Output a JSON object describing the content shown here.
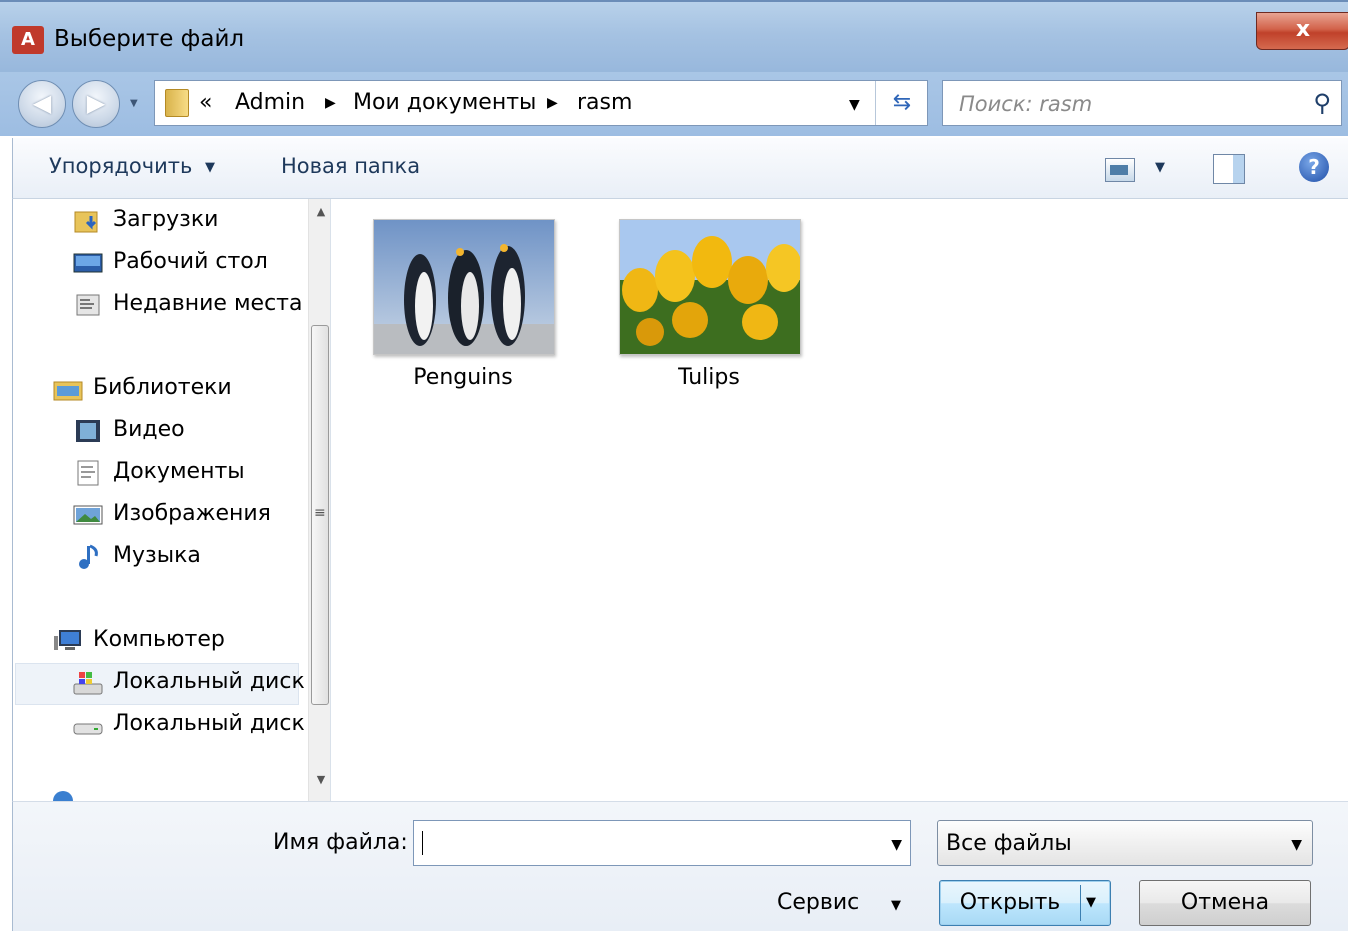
{
  "window": {
    "title": "Выберите файл",
    "app_icon_text": "A",
    "close_label": "x"
  },
  "nav": {
    "back_icon": "back-arrow-icon",
    "forward_icon": "forward-arrow-icon",
    "breadcrumb": {
      "overflow": "«",
      "parts": [
        "Admin",
        "Мои документы",
        "rasm"
      ]
    },
    "search_placeholder": "Поиск: rasm"
  },
  "toolbar": {
    "organize_label": "Упорядочить",
    "new_folder_label": "Новая папка"
  },
  "sidebar": {
    "items": [
      {
        "label": "Загрузки",
        "icon": "downloads-folder-icon"
      },
      {
        "label": "Рабочий стол",
        "icon": "desktop-icon"
      },
      {
        "label": "Недавние места",
        "icon": "recent-places-icon"
      },
      {
        "label": "Библиотеки",
        "icon": "libraries-icon"
      },
      {
        "label": "Видео",
        "icon": "video-icon"
      },
      {
        "label": "Документы",
        "icon": "documents-icon"
      },
      {
        "label": "Изображения",
        "icon": "pictures-icon"
      },
      {
        "label": "Музыка",
        "icon": "music-icon"
      },
      {
        "label": "Компьютер",
        "icon": "computer-icon"
      },
      {
        "label": "Локальный диск",
        "icon": "system-drive-icon"
      },
      {
        "label": "Локальный диск",
        "icon": "drive-icon"
      }
    ]
  },
  "files": [
    {
      "name": "Penguins",
      "thumbnail": "penguins-image"
    },
    {
      "name": "Tulips",
      "thumbnail": "tulips-image"
    }
  ],
  "footer": {
    "filename_label": "Имя файла:",
    "filename_value": "",
    "filetype_value": "Все файлы",
    "service_label": "Сервис",
    "open_label": "Открыть",
    "cancel_label": "Отмена"
  },
  "colors": {
    "titlebar": "#a5c2e2",
    "close_button": "#c0412a",
    "accent": "#3c7fb1"
  }
}
